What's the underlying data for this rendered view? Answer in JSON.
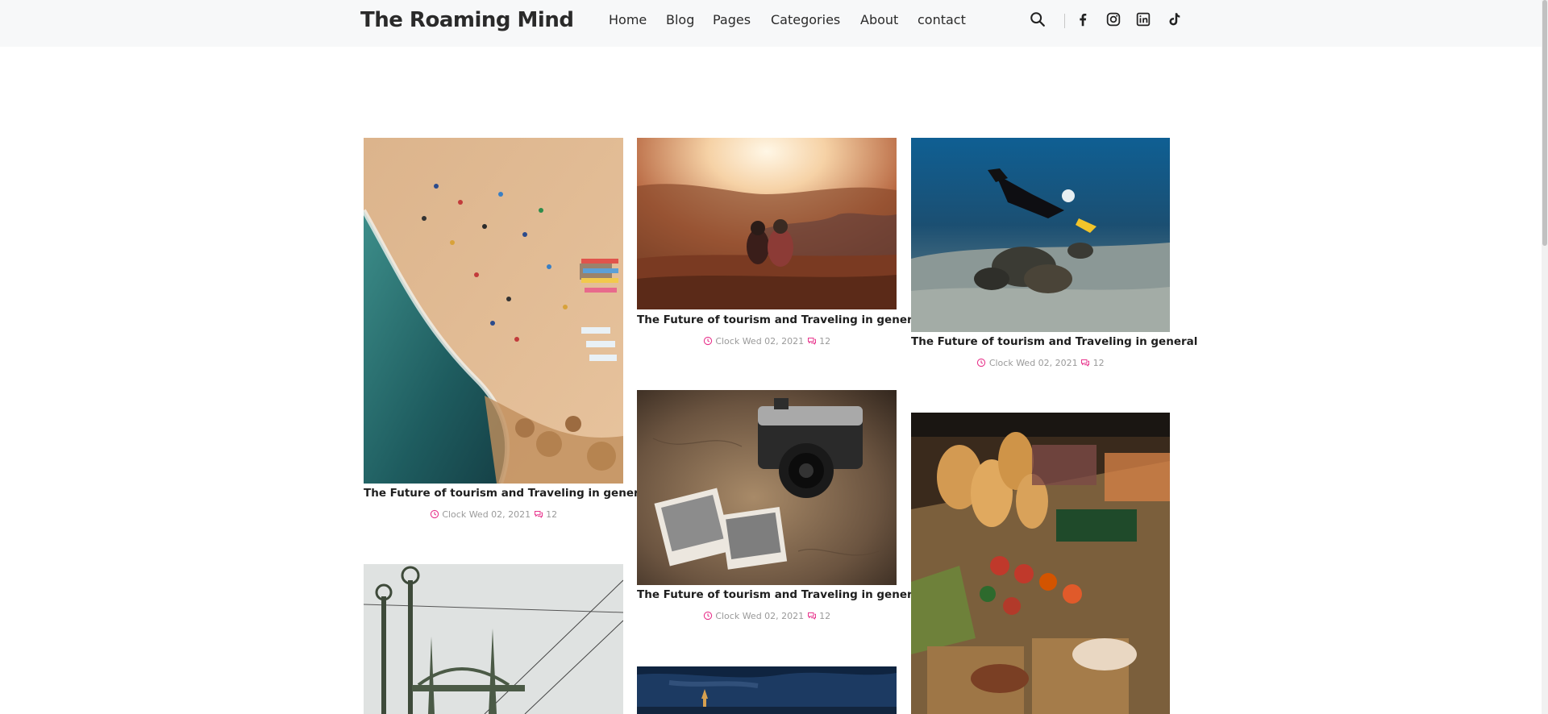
{
  "site": {
    "title": "The Roaming Mind"
  },
  "nav": {
    "items": [
      {
        "label": "Home"
      },
      {
        "label": "Blog"
      },
      {
        "label": "Pages"
      },
      {
        "label": "Categories"
      },
      {
        "label": "About"
      },
      {
        "label": "contact"
      }
    ]
  },
  "header_icons": [
    "search-icon",
    "facebook-icon",
    "instagram-icon",
    "linkedin-icon",
    "tiktok-icon"
  ],
  "accent_color": "#e8358d",
  "posts": [
    {
      "image": "aerial beach with umbrellas and boats",
      "title": "The Future of tourism and Traveling in general",
      "date": "Clock Wed 02, 2021",
      "comments": "12"
    },
    {
      "image": "couple sitting on canyon edge at sunset",
      "title": "The Future of tourism and Traveling in general",
      "date": "Clock Wed 02, 2021",
      "comments": "12"
    },
    {
      "image": "scuba diver over coral on sea floor",
      "title": "The Future of tourism and Traveling in general",
      "date": "Clock Wed 02, 2021",
      "comments": "12"
    },
    {
      "image": "vintage camera and photos on a map",
      "title": "The Future of tourism and Traveling in general",
      "date": "Clock Wed 02, 2021",
      "comments": "12"
    },
    {
      "image": "street food grill with bread and skewers",
      "title": "",
      "date": "",
      "comments": ""
    },
    {
      "image": "bridge towers and tram wires",
      "title": "",
      "date": "",
      "comments": ""
    },
    {
      "image": "night sky over city",
      "title": "",
      "date": "",
      "comments": ""
    }
  ]
}
